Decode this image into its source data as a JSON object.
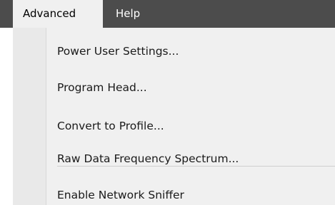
{
  "menubar": {
    "items": [
      {
        "label": "Advanced"
      },
      {
        "label": "Help"
      }
    ]
  },
  "dropdown": {
    "items": [
      {
        "label": "Power User Settings..."
      },
      {
        "label": "Program Head..."
      },
      {
        "label": "Convert to Profile..."
      },
      {
        "label": "Raw Data Frequency Spectrum..."
      },
      {
        "label": "Enable Network Sniffer"
      }
    ]
  },
  "colors": {
    "menubar_bg": "#4c4c4c",
    "menu_bg": "#f0f0f0",
    "gutter_bg": "#e9e9e9",
    "text": "#1a1a1a"
  }
}
